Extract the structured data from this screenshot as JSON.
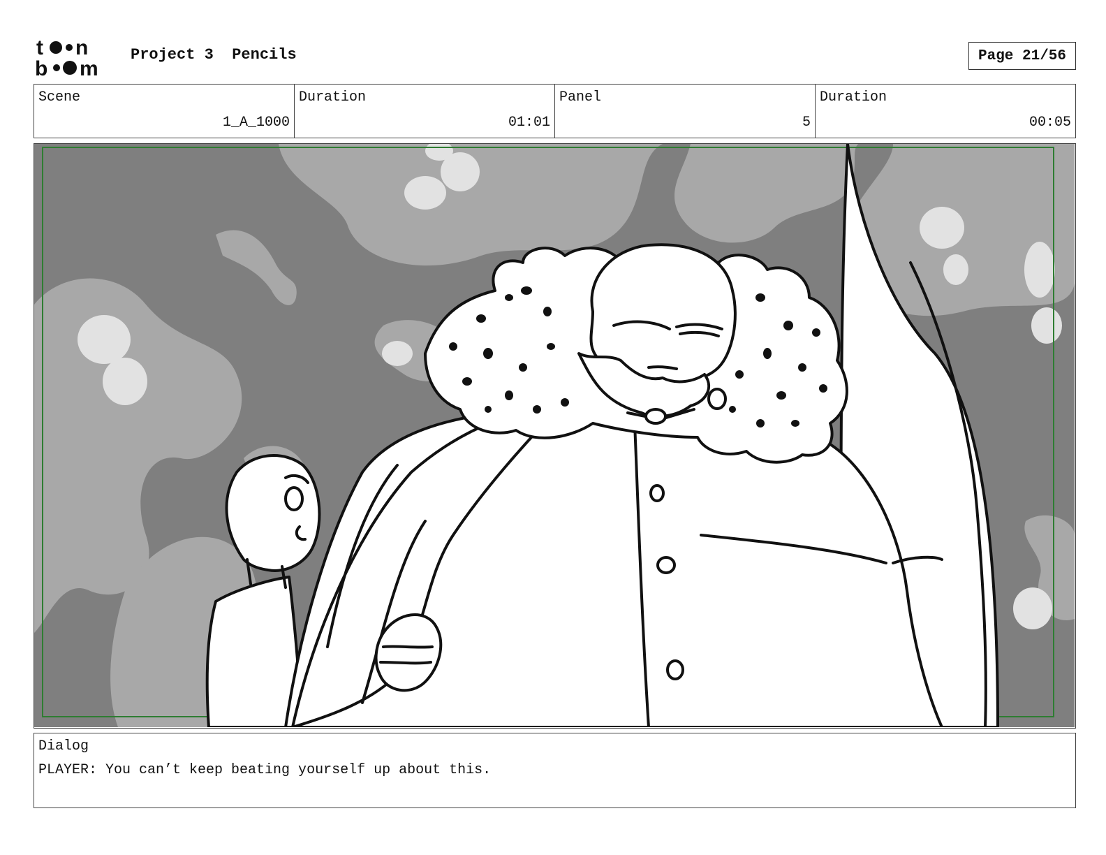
{
  "header": {
    "logo_top": "t••n",
    "logo_bottom": "b••m",
    "project": "Project 3",
    "stage": "Pencils",
    "page": "Page 21/56"
  },
  "meta": {
    "scene_label": "Scene",
    "scene_value": "1_A_1000",
    "scene_duration_label": "Duration",
    "scene_duration_value": "01:01",
    "panel_label": "Panel",
    "panel_value": "5",
    "panel_duration_label": "Duration",
    "panel_duration_value": "00:05"
  },
  "dialog": {
    "label": "Dialog",
    "text": "PLAYER: You can’t keep beating yourself up about this."
  },
  "colors": {
    "sky_dark": "#7f7f7f",
    "cloud_mid": "#a8a8a8",
    "cloud_light": "#e2e2e2",
    "safe_frame": "#2e7d32",
    "ink": "#111111"
  }
}
